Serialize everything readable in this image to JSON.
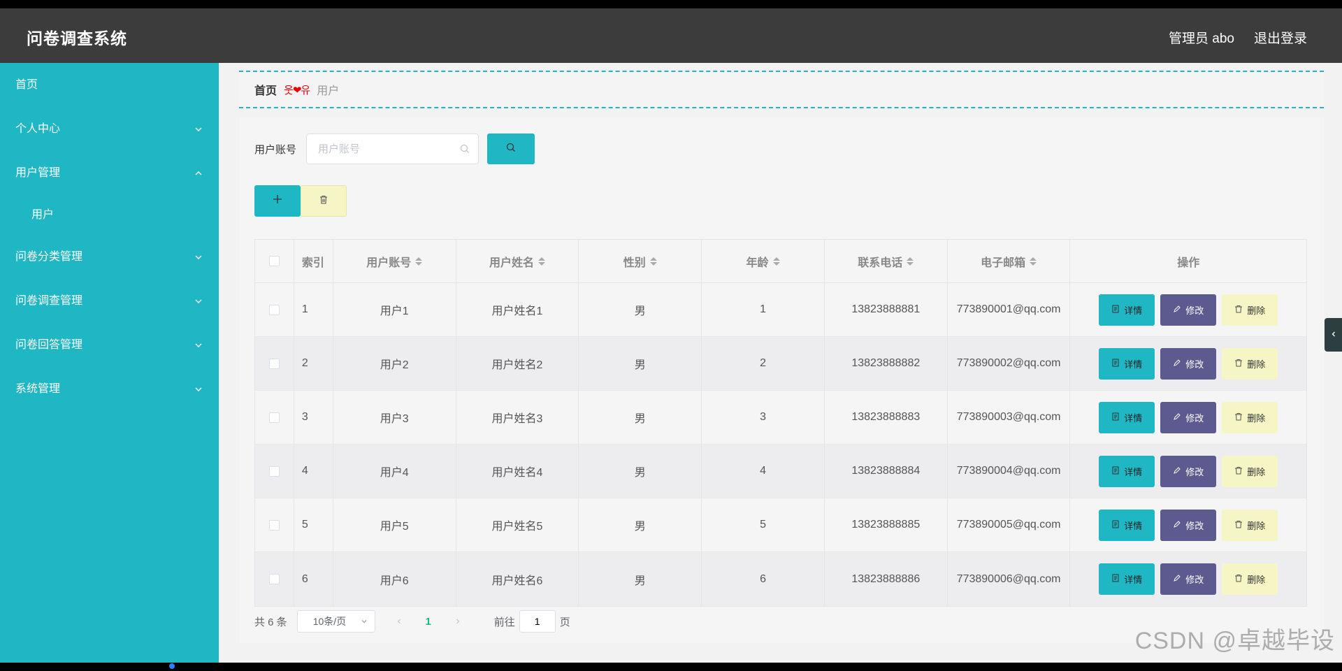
{
  "header": {
    "title": "问卷调查系统",
    "user": "管理员 abo",
    "logout": "退出登录"
  },
  "sidebar": {
    "items": [
      {
        "label": "首页"
      },
      {
        "label": "个人中心"
      },
      {
        "label": "用户管理"
      },
      {
        "label": "问卷分类管理"
      },
      {
        "label": "问卷调查管理"
      },
      {
        "label": "问卷回答管理"
      },
      {
        "label": "系统管理"
      }
    ],
    "sub_items": [
      {
        "label": "用户"
      }
    ]
  },
  "breadcrumb": {
    "home": "首页",
    "separator": "웃❤유",
    "current": "用户"
  },
  "search": {
    "label": "用户账号",
    "placeholder": "用户账号"
  },
  "table": {
    "headers": {
      "index": "索引",
      "account": "用户账号",
      "name": "用户姓名",
      "gender": "性别",
      "age": "年龄",
      "phone": "联系电话",
      "email": "电子邮箱",
      "ops": "操作"
    },
    "rows": [
      {
        "index": "1",
        "account": "用户1",
        "name": "用户姓名1",
        "gender": "男",
        "age": "1",
        "phone": "13823888881",
        "email": "773890001@qq.com"
      },
      {
        "index": "2",
        "account": "用户2",
        "name": "用户姓名2",
        "gender": "男",
        "age": "2",
        "phone": "13823888882",
        "email": "773890002@qq.com"
      },
      {
        "index": "3",
        "account": "用户3",
        "name": "用户姓名3",
        "gender": "男",
        "age": "3",
        "phone": "13823888883",
        "email": "773890003@qq.com"
      },
      {
        "index": "4",
        "account": "用户4",
        "name": "用户姓名4",
        "gender": "男",
        "age": "4",
        "phone": "13823888884",
        "email": "773890004@qq.com"
      },
      {
        "index": "5",
        "account": "用户5",
        "name": "用户姓名5",
        "gender": "男",
        "age": "5",
        "phone": "13823888885",
        "email": "773890005@qq.com"
      },
      {
        "index": "6",
        "account": "用户6",
        "name": "用户姓名6",
        "gender": "男",
        "age": "6",
        "phone": "13823888886",
        "email": "773890006@qq.com"
      }
    ],
    "row_buttons": {
      "detail": "详情",
      "edit": "修改",
      "delete": "删除"
    }
  },
  "pagination": {
    "total": "共 6 条",
    "page_size": "10条/页",
    "current_page": "1",
    "goto_label": "前往",
    "goto_value": "1",
    "page_unit": "页"
  },
  "watermark": "CSDN @卓越毕设",
  "colors": {
    "accent": "#1fb7c4",
    "header_bg": "#3c3c3c",
    "edit_button": "#5c5a8e",
    "delete_button": "#f5f5c5"
  }
}
